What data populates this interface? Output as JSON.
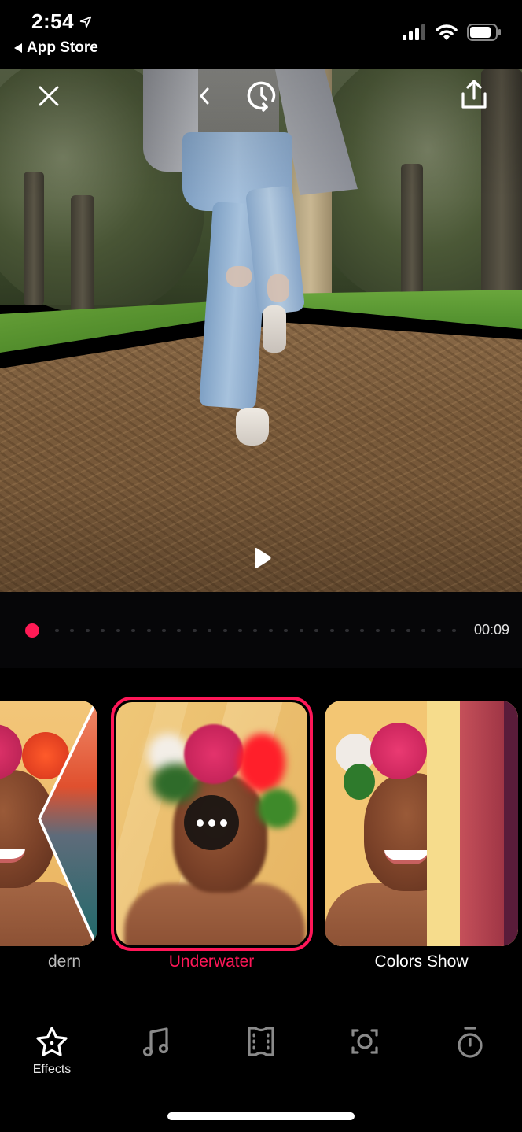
{
  "status_bar": {
    "time": "2:54",
    "location_icon": "location-arrow-icon",
    "back_app_label": "App Store",
    "signal_icon": "cellular-signal-icon",
    "wifi_icon": "wifi-icon",
    "battery_icon": "battery-icon"
  },
  "video_toolbar": {
    "close_icon": "close-icon",
    "back_icon": "chevron-left-icon",
    "history_icon": "clock-history-icon",
    "share_icon": "share-icon",
    "play_icon": "play-icon"
  },
  "timeline": {
    "current_time": "00:09",
    "progress": 0.0,
    "accent_color": "#ff1a55"
  },
  "effects": {
    "selected_index": 1,
    "items": [
      {
        "label": "Modern",
        "visible_label": "dern"
      },
      {
        "label": "Underwater",
        "selected": true
      },
      {
        "label": "Colors Show"
      }
    ],
    "more_icon": "more-options-icon",
    "selected_color": "#ff1758"
  },
  "tabbar": {
    "tabs": [
      {
        "id": "effects",
        "label": "Effects",
        "icon": "star-icon",
        "active": true
      },
      {
        "id": "music",
        "label": "",
        "icon": "music-note-icon",
        "active": false
      },
      {
        "id": "film",
        "label": "",
        "icon": "film-strip-icon",
        "active": false
      },
      {
        "id": "focus",
        "label": "",
        "icon": "focus-frame-icon",
        "active": false
      },
      {
        "id": "timer",
        "label": "",
        "icon": "stopwatch-icon",
        "active": false
      }
    ]
  }
}
